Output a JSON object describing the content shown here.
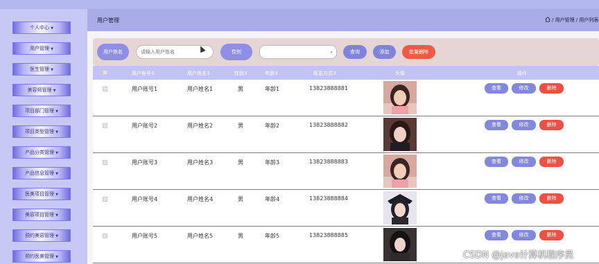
{
  "sidebar": {
    "items": [
      {
        "label": "个人中心"
      },
      {
        "label": "用户管理"
      },
      {
        "label": "医生管理"
      },
      {
        "label": "美容师管理"
      },
      {
        "label": "项目部门管理"
      },
      {
        "label": "项目类型管理"
      },
      {
        "label": "产品分类管理"
      },
      {
        "label": "产品信息管理"
      },
      {
        "label": "医美项目管理"
      },
      {
        "label": "美容项目管理"
      },
      {
        "label": "预约美容管理"
      },
      {
        "label": "预约医美管理"
      }
    ]
  },
  "header": {
    "title": "用户管理",
    "breadcrumb": "/ 用户管理 / 用户列表"
  },
  "search": {
    "name_label": "用户姓名",
    "name_placeholder": "请输入用户姓名",
    "gender_label": "性别",
    "gender_value": "",
    "query_button": "查询",
    "add_button": "添加",
    "batch_delete_button": "批量删除"
  },
  "table": {
    "columns": [
      "用户账号",
      "用户姓名",
      "性别",
      "年龄",
      "联系方式",
      "头像",
      "操作"
    ],
    "sort_mark": "⇕",
    "rows": [
      {
        "account": "用户账号1",
        "name": "用户姓名1",
        "gender": "男",
        "age": "年龄1",
        "phone": "13823888881",
        "avatar": "avatar-photo-1"
      },
      {
        "account": "用户账号2",
        "name": "用户姓名2",
        "gender": "男",
        "age": "年龄2",
        "phone": "13823888882",
        "avatar": "avatar-photo-2"
      },
      {
        "account": "用户账号3",
        "name": "用户姓名3",
        "gender": "男",
        "age": "年龄3",
        "phone": "13823888883",
        "avatar": "avatar-photo-3"
      },
      {
        "account": "用户账号4",
        "name": "用户姓名4",
        "gender": "男",
        "age": "年龄4",
        "phone": "13823888884",
        "avatar": "avatar-photo-4"
      },
      {
        "account": "用户账号5",
        "name": "用户姓名5",
        "gender": "男",
        "age": "年龄5",
        "phone": "13823888885",
        "avatar": "avatar-photo-5"
      }
    ],
    "actions": {
      "view": "查看",
      "edit": "修改",
      "delete": "删除"
    }
  },
  "watermark": "CSDN @java计算机程序员",
  "colors": {
    "sidebar_bg": "#c7c9f4",
    "header_bg": "#a8abe6",
    "accent_blue": "#8288dc",
    "danger_red": "#ef4f45",
    "search_bg": "#e5d6d6"
  }
}
